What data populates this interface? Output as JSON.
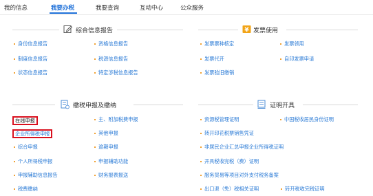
{
  "tabs": [
    {
      "label": "我的信息"
    },
    {
      "label": "我要办税"
    },
    {
      "label": "我要查询"
    },
    {
      "label": "互动中心"
    },
    {
      "label": "公众服务"
    }
  ],
  "colors": {
    "accent": "#1c6fd8",
    "link": "#2b7bd6",
    "highlight_box": "#d9101e",
    "bullet": "#f0a030"
  },
  "sections": {
    "comprehensive": {
      "title": "综合信息报告",
      "icon": "document-edit-icon",
      "items": [
        "身份信息报告",
        "资格信息报告",
        "制度信息报告",
        "税源信息报告",
        "状态信息报告",
        "特定涉税信息报告"
      ]
    },
    "invoice": {
      "title": "发票使用",
      "icon": "yen-icon",
      "items": [
        "发票票种核定",
        "发票领用",
        "发票代开",
        "自印发票申请",
        "发票验旧缴销"
      ]
    },
    "filing": {
      "title": "缴税申报及缴纳",
      "icon": "tax-form-icon",
      "items": [
        "在线申报",
        "主、附加税费申报",
        "企业所得税申报",
        "其他申报",
        "综合申报",
        "逾期申报",
        "个人所得税申报",
        "申报辅助功能",
        "申报辅助信息报告",
        "财务报表报送",
        "税费缴纳"
      ]
    },
    "certificate": {
      "title": "证明开具",
      "icon": "certificate-icon",
      "items": [
        "资源税管理证明",
        "中国税收居民身份证明",
        "转开印花税票销售凭证",
        "非居民企业汇总申报企业所得税证明",
        "开具税收完税（费）证明",
        "服务贸易等项目对外支付税务备案",
        "出口退（免）税相关证明",
        "转开税收完税证明"
      ]
    }
  }
}
